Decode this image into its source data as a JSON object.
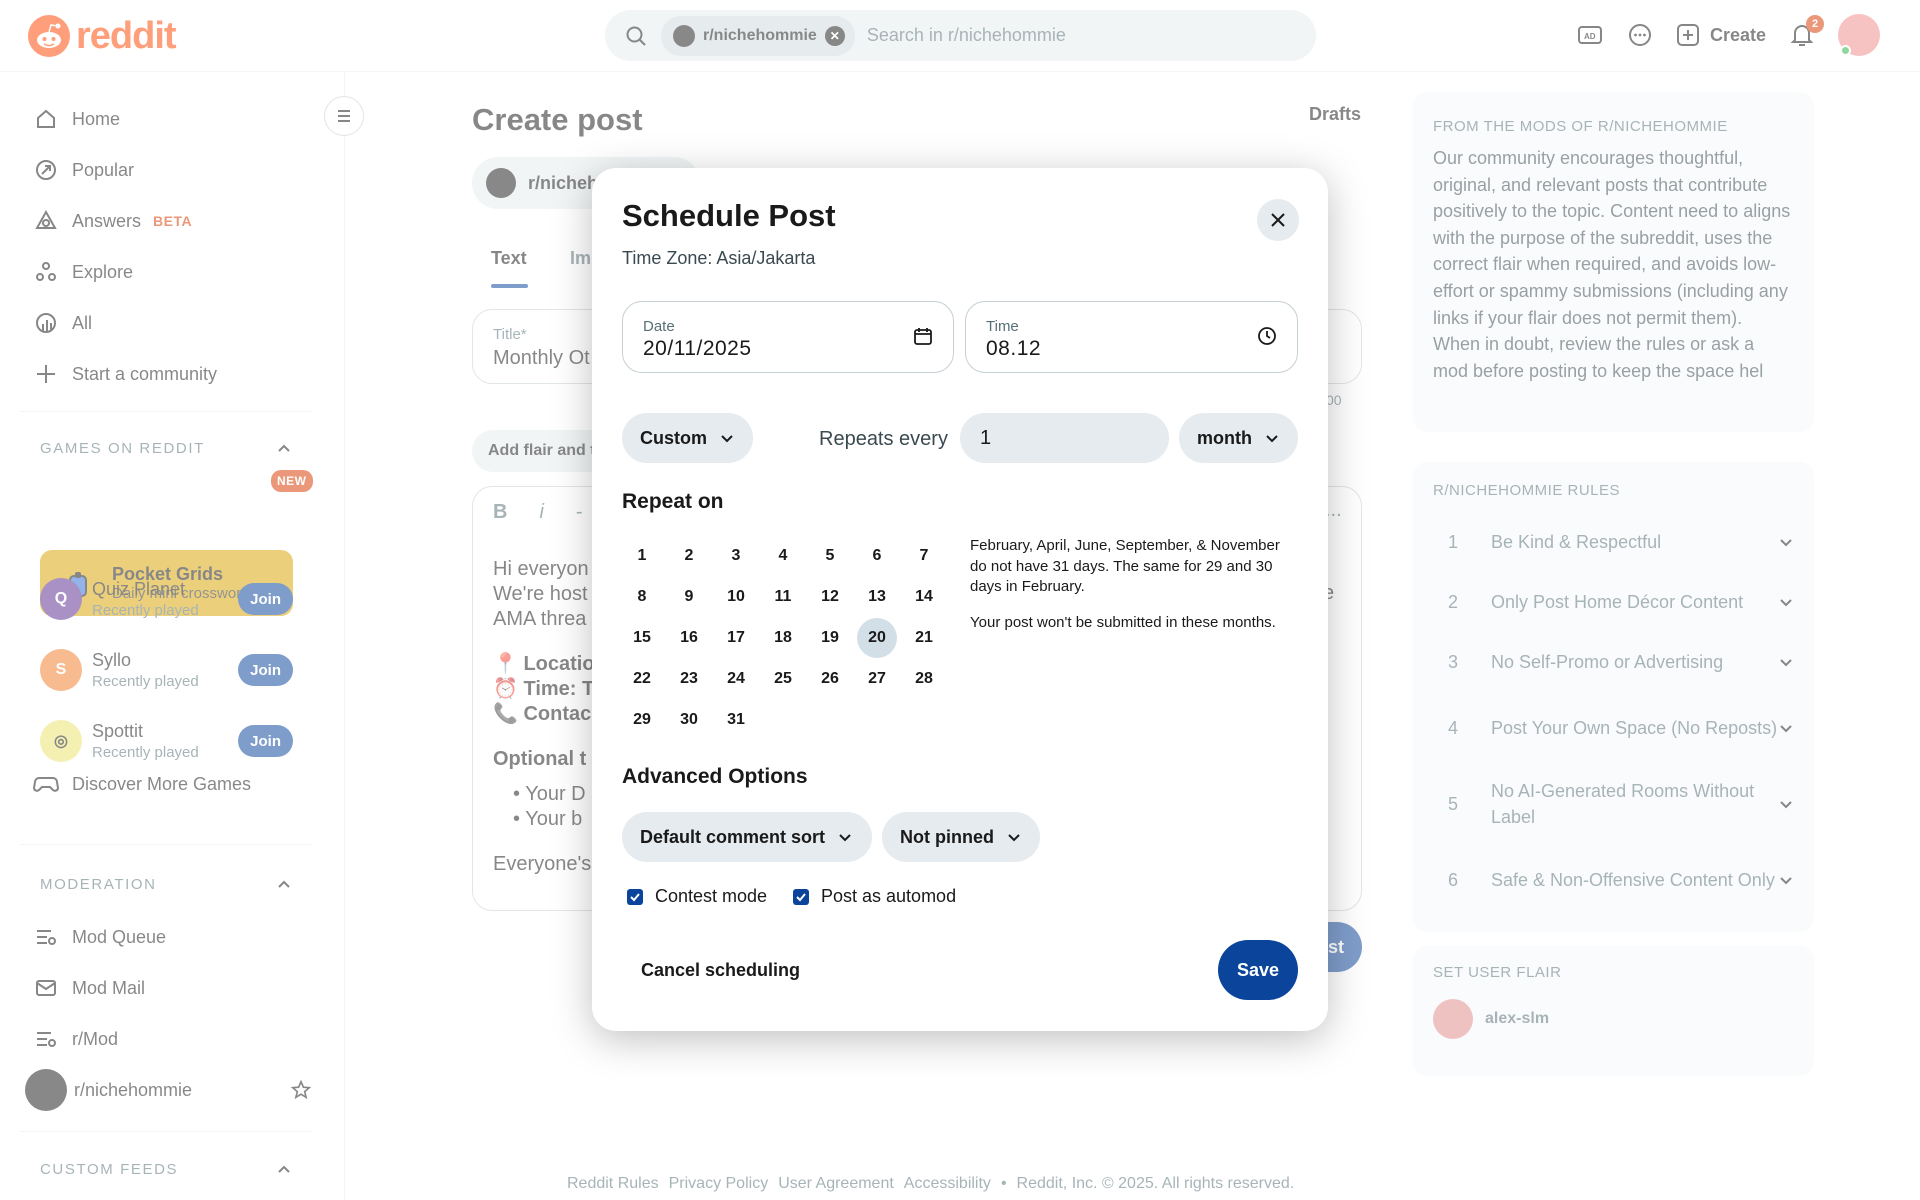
{
  "header": {
    "logo_text": "reddit",
    "search_chip": "r/nichehommie",
    "search_placeholder": "Search in r/nichehommie",
    "create_label": "Create",
    "notification_count": "2",
    "icons": [
      "search-icon",
      "advertise-icon",
      "chat-icon",
      "plus-icon",
      "bell-icon"
    ]
  },
  "sidebar": {
    "nav": [
      {
        "label": "Home",
        "icon": "home-icon"
      },
      {
        "label": "Popular",
        "icon": "popular-icon"
      },
      {
        "label": "Answers",
        "icon": "answers-icon",
        "badge": "BETA"
      },
      {
        "label": "Explore",
        "icon": "explore-icon"
      },
      {
        "label": "All",
        "icon": "all-icon"
      },
      {
        "label": "Start a community",
        "icon": "plus-icon"
      }
    ],
    "games_title": "GAMES ON REDDIT",
    "promo": {
      "title": "Pocket Grids",
      "subtitle": "Daily mini crosswords",
      "badge": "NEW"
    },
    "games": [
      {
        "name": "Quiz Planet",
        "sub": "Recently played",
        "join": "Join"
      },
      {
        "name": "Syllo",
        "sub": "Recently played",
        "join": "Join"
      },
      {
        "name": "Spottit",
        "sub": "Recently played",
        "join": "Join"
      }
    ],
    "discover": "Discover More Games",
    "moderation_title": "MODERATION",
    "moderation": [
      {
        "label": "Mod Queue"
      },
      {
        "label": "Mod Mail"
      },
      {
        "label": "r/Mod"
      },
      {
        "label": "r/nichehommie"
      }
    ],
    "custom_feeds_title": "CUSTOM FEEDS"
  },
  "main": {
    "title": "Create post",
    "drafts": "Drafts",
    "community": "r/nicheh",
    "tabs": [
      "Text",
      "Im"
    ],
    "title_label": "Title*",
    "title_value": "Monthly Ot",
    "char_count": "00",
    "flair_btn": "Add flair and t",
    "toolbar": [
      "B",
      "i",
      "-",
      "..."
    ],
    "body_lines": [
      "Hi everyon",
      "We're host",
      "AMA threa"
    ],
    "loc_line": "📍 Locatio",
    "time_line": "⏰ Time: T",
    "contact_line": "📞 Contac",
    "optional_line": "Optional t",
    "bullets": [
      "Your D",
      "Your b"
    ],
    "last_line": "Everyone's",
    "right_e": "e",
    "post_btn": "st"
  },
  "footer": [
    "Reddit Rules",
    "Privacy Policy",
    "User Agreement",
    "Accessibility",
    "•",
    "Reddit, Inc. © 2025. All rights reserved."
  ],
  "right": {
    "mods_title": "FROM THE MODS OF R/NICHEHOMMIE",
    "mods_text": "Our community encourages thoughtful, original, and relevant posts that contribute positively to the topic. Content need to aligns with the purpose of the subreddit, uses the correct flair when required, and avoids low-effort or spammy submissions (including any links if your flair does not permit them). When in doubt, review the rules or ask a mod before posting to keep the space hel",
    "rules_title": "R/NICHEHOMMIE RULES",
    "rules": [
      {
        "n": "1",
        "t": "Be Kind & Respectful"
      },
      {
        "n": "2",
        "t": "Only Post Home Décor Content"
      },
      {
        "n": "3",
        "t": "No Self-Promo or Advertising"
      },
      {
        "n": "4",
        "t": "Post Your Own Space (No Reposts)"
      },
      {
        "n": "5",
        "t": "No AI-Generated Rooms Without Label"
      },
      {
        "n": "6",
        "t": "Safe & Non-Offensive Content Only"
      }
    ],
    "flair_title": "SET USER FLAIR",
    "flair_user": "alex-slm"
  },
  "modal": {
    "title": "Schedule Post",
    "timezone": "Time Zone: Asia/Jakarta",
    "date_label": "Date",
    "date_value": "20/11/2025",
    "time_label": "Time",
    "time_value": "08.12",
    "frequency": "Custom",
    "repeats_label": "Repeats every",
    "repeats_value": "1",
    "unit": "month",
    "repeat_on_title": "Repeat on",
    "days": [
      "1",
      "2",
      "3",
      "4",
      "5",
      "6",
      "7",
      "8",
      "9",
      "10",
      "11",
      "12",
      "13",
      "14",
      "15",
      "16",
      "17",
      "18",
      "19",
      "20",
      "21",
      "22",
      "23",
      "24",
      "25",
      "26",
      "27",
      "28",
      "29",
      "30",
      "31"
    ],
    "selected_day": "20",
    "note1": "February, April, June, September, & November do not have 31 days. The same for 29 and 30 days in February.",
    "note2": "Your post won't be submitted in these months.",
    "advanced_title": "Advanced Options",
    "comment_sort": "Default comment sort",
    "pinned": "Not pinned",
    "contest_mode": "Contest mode",
    "post_as_automod": "Post as automod",
    "cancel": "Cancel scheduling",
    "save": "Save"
  },
  "colors": {
    "brand": "#ff4500",
    "primary": "#0a449b",
    "surface": "#e5ebee",
    "promo": "#d8a400"
  }
}
